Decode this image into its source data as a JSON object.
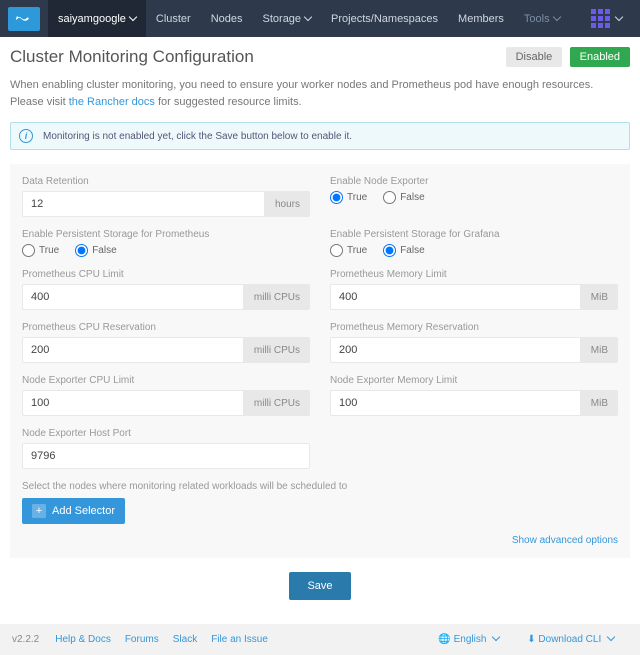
{
  "nav": {
    "cluster_name": "saiyamgoogle",
    "items": {
      "cluster": "Cluster",
      "nodes": "Nodes",
      "storage": "Storage",
      "projects": "Projects/Namespaces",
      "members": "Members",
      "tools": "Tools"
    }
  },
  "page_title": "Cluster Monitoring Configuration",
  "actions": {
    "disable": "Disable",
    "enabled": "Enabled"
  },
  "description": {
    "pre": "When enabling cluster monitoring, you need to ensure your worker nodes and Prometheus pod have enough resources. Please visit ",
    "link": "the Rancher docs",
    "post": " for suggested resource limits."
  },
  "banner": "Monitoring is not enabled yet, click the Save button below to enable it.",
  "labels": {
    "data_retention": "Data Retention",
    "enable_node_exporter": "Enable Node Exporter",
    "enable_storage_prom": "Enable Persistent Storage for Prometheus",
    "enable_storage_grafana": "Enable Persistent Storage for Grafana",
    "prom_cpu_limit": "Prometheus CPU Limit",
    "prom_mem_limit": "Prometheus Memory Limit",
    "prom_cpu_res": "Prometheus CPU Reservation",
    "prom_mem_res": "Prometheus Memory Reservation",
    "ne_cpu_limit": "Node Exporter CPU Limit",
    "ne_mem_limit": "Node Exporter Memory Limit",
    "ne_host_port": "Node Exporter Host Port",
    "selector_text": "Select the nodes where monitoring related workloads will be scheduled to",
    "add_selector": "Add Selector",
    "advanced": "Show advanced options",
    "save": "Save"
  },
  "units": {
    "hours": "hours",
    "mcpu": "milli CPUs",
    "mib": "MiB"
  },
  "radio": {
    "t": "True",
    "f": "False"
  },
  "values": {
    "data_retention": "12",
    "enable_node_exporter": "true",
    "storage_prom": "false",
    "storage_grafana": "false",
    "prom_cpu_limit": "400",
    "prom_mem_limit": "400",
    "prom_cpu_res": "200",
    "prom_mem_res": "200",
    "ne_cpu_limit": "100",
    "ne_mem_limit": "100",
    "ne_host_port": "9796"
  },
  "footer": {
    "version": "v2.2.2",
    "help": "Help & Docs",
    "forums": "Forums",
    "slack": "Slack",
    "issue": "File an Issue",
    "english": "English",
    "download": "Download CLI"
  }
}
